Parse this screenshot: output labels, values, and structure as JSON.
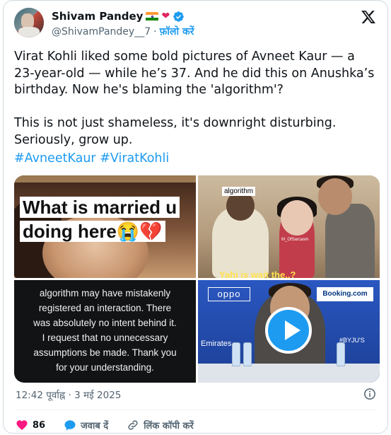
{
  "author": {
    "name": "Shivam Pandey",
    "handle": "@ShivamPandey__7",
    "separator": "·",
    "follow_label": "फ़ॉलो करें",
    "avatar_icon": "avatar-photo",
    "badges": [
      "india-flag-icon",
      "red-heart-icon",
      "verified-badge-icon"
    ]
  },
  "platform_icon": "x-logo-icon",
  "tweet": {
    "text": "Virat Kohli liked some bold pictures of Avneet Kaur — a 23-year-old — while he’s 37. And he did this on Anushka’s birthday. Now he's blaming the 'algorithm'?\n\nThis is not just shameless, it's downright disturbing. Seriously, grow up.",
    "hashtags": [
      "#AvneetKaur",
      "#ViratKohli"
    ]
  },
  "media": {
    "tile1": {
      "caption_line1": "What is married u",
      "caption_line2": "doing here😭💔"
    },
    "tile2": {
      "label": "algorithm",
      "watermark": "M_OfSarcasm",
      "bottom_text": "Yahi is wait the..?"
    },
    "tile3": {
      "lines": [
        "algorithm may have mistakenly",
        "registered an interaction. There",
        "was absolutely no intent behind it.",
        "I request that no unnecessary",
        "assumptions be made. Thank you",
        "for your understanding."
      ]
    },
    "tile4": {
      "oppo": "oppo",
      "booking": "Booking.com",
      "emirates": "Emirates",
      "side_text": "#BYJU'S",
      "play_icon": "play-icon"
    }
  },
  "timestamp": "12:42 पूर्वाह्न · 3 मई 2025",
  "actions": {
    "likes_count": "86",
    "reply_label": "जवाब दें",
    "copy_link_label": "लिंक कॉपी करें"
  },
  "colors": {
    "accent": "#1d9bf0",
    "like": "#f91880",
    "text": "#0f1419",
    "muted": "#536471"
  }
}
